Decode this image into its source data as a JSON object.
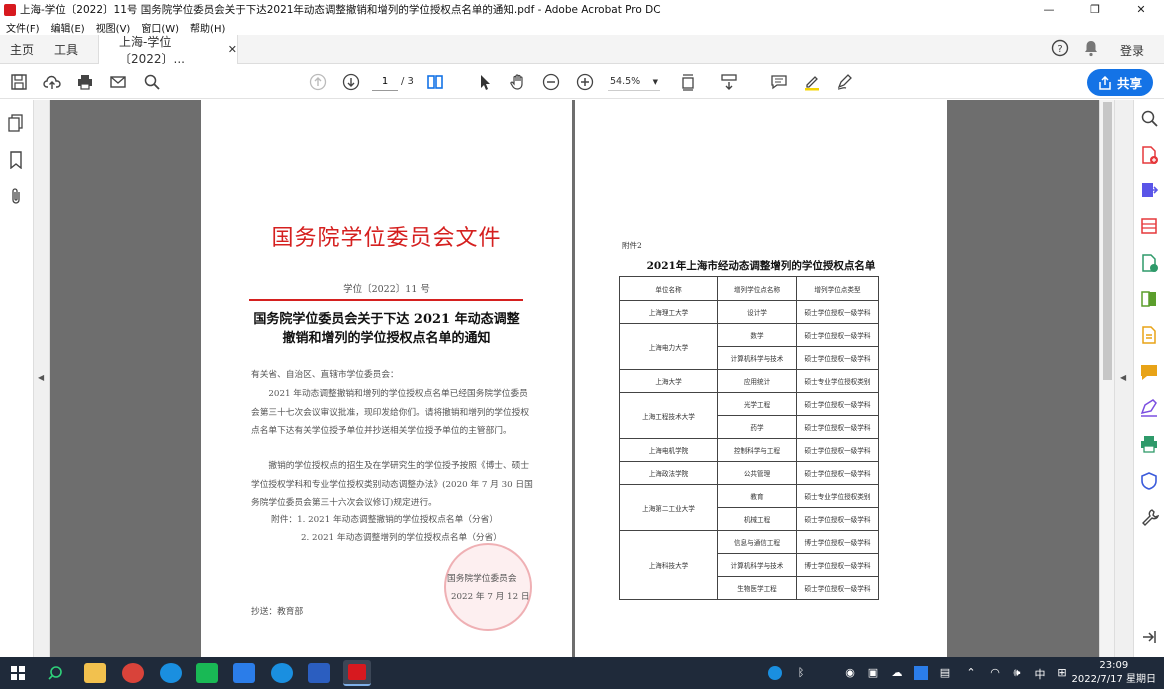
{
  "window": {
    "title": "上海-学位〔2022〕11号 国务院学位委员会关于下达2021年动态调整撤销和增列的学位授权点名单的通知.pdf - Adobe Acrobat Pro DC"
  },
  "menu": [
    "文件(F)",
    "编辑(E)",
    "视图(V)",
    "窗口(W)",
    "帮助(H)"
  ],
  "tabs": {
    "home": "主页",
    "tools": "工具",
    "doc": "上海-学位〔2022〕..."
  },
  "header": {
    "login": "登录"
  },
  "toolbar": {
    "page_current": "1",
    "page_total": "/ 3",
    "zoom": "54.5%",
    "share": "共享"
  },
  "page1": {
    "header": "国务院学位委员会文件",
    "doc_number": "学位〔2022〕11 号",
    "title_line1": "国务院学位委员会关于下达 2021 年动态调整",
    "title_line2": "撤销和增列的学位授权点名单的通知",
    "salutation": "有关省、自治区、直辖市学位委员会：",
    "para1": "2021 年动态调整撤销和增列的学位授权点名单已经国务院学位委员会第三十七次会议审议批准，现印发给你们。请将撤销和增列的学位授权点名单下达有关学位授予单位并抄送相关学位授予单位的主管部门。",
    "para2": "撤销的学位授权点的招生及在学研究生的学位授予按照《博士、硕士学位授权学科和专业学位授权类别动态调整办法》(2020 年 7 月 30 日国务院学位委员会第三十六次会议修订)规定进行。",
    "attach1": "附件：1. 2021 年动态调整撤销的学位授权点名单（分省）",
    "attach2": "2. 2021 年动态调整增列的学位授权点名单（分省）",
    "signer": "国务院学位委员会",
    "date": "2022 年 7 月 12 日",
    "cc": "抄送：教育部"
  },
  "page2": {
    "attachment_label": "附件2",
    "title": "2021年上海市经动态调整增列的学位授权点名单",
    "columns": [
      "单位名称",
      "增列学位点名称",
      "增列学位点类型"
    ],
    "groups": [
      {
        "unit": "上海理工大学",
        "rows": [
          [
            "设计学",
            "硕士学位授权一级学科"
          ]
        ]
      },
      {
        "unit": "上海电力大学",
        "rows": [
          [
            "数学",
            "硕士学位授权一级学科"
          ],
          [
            "计算机科学与技术",
            "硕士学位授权一级学科"
          ]
        ]
      },
      {
        "unit": "上海大学",
        "rows": [
          [
            "应用统计",
            "硕士专业学位授权类别"
          ]
        ]
      },
      {
        "unit": "上海工程技术大学",
        "rows": [
          [
            "光学工程",
            "硕士学位授权一级学科"
          ],
          [
            "药学",
            "硕士学位授权一级学科"
          ]
        ]
      },
      {
        "unit": "上海电机学院",
        "rows": [
          [
            "控制科学与工程",
            "硕士学位授权一级学科"
          ]
        ]
      },
      {
        "unit": "上海政法学院",
        "rows": [
          [
            "公共管理",
            "硕士学位授权一级学科"
          ]
        ]
      },
      {
        "unit": "上海第二工业大学",
        "rows": [
          [
            "教育",
            "硕士专业学位授权类别"
          ],
          [
            "机械工程",
            "硕士学位授权一级学科"
          ]
        ]
      },
      {
        "unit": "上海科技大学",
        "rows": [
          [
            "信息与通信工程",
            "博士学位授权一级学科"
          ],
          [
            "计算机科学与技术",
            "博士学位授权一级学科"
          ],
          [
            "生物医学工程",
            "硕士学位授权一级学科"
          ]
        ]
      }
    ]
  },
  "taskbar": {
    "time": "23:09",
    "date": "2022/7/17 星期日",
    "ime": "中",
    "volume": "🕪"
  },
  "colors": {
    "accent": "#1473e6",
    "doc_red": "#d5201f",
    "canvas": "#6e6e6e"
  }
}
